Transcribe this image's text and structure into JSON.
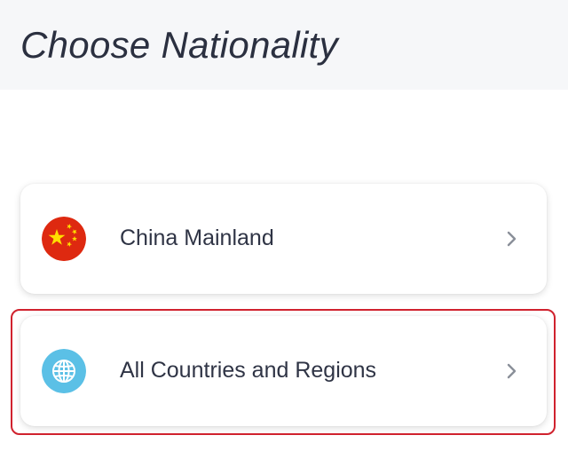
{
  "header": {
    "title": "Choose Nationality"
  },
  "options": [
    {
      "label": "China Mainland",
      "icon": "china-flag-icon"
    },
    {
      "label": "All Countries and Regions",
      "icon": "globe-icon"
    }
  ],
  "colors": {
    "header_bg": "#f6f7f9",
    "title_text": "#2b3040",
    "china_red": "#de2910",
    "china_star": "#ffde00",
    "globe_blue": "#5bc0e6",
    "chevron": "#8a8f99",
    "highlight": "#d0222e"
  }
}
